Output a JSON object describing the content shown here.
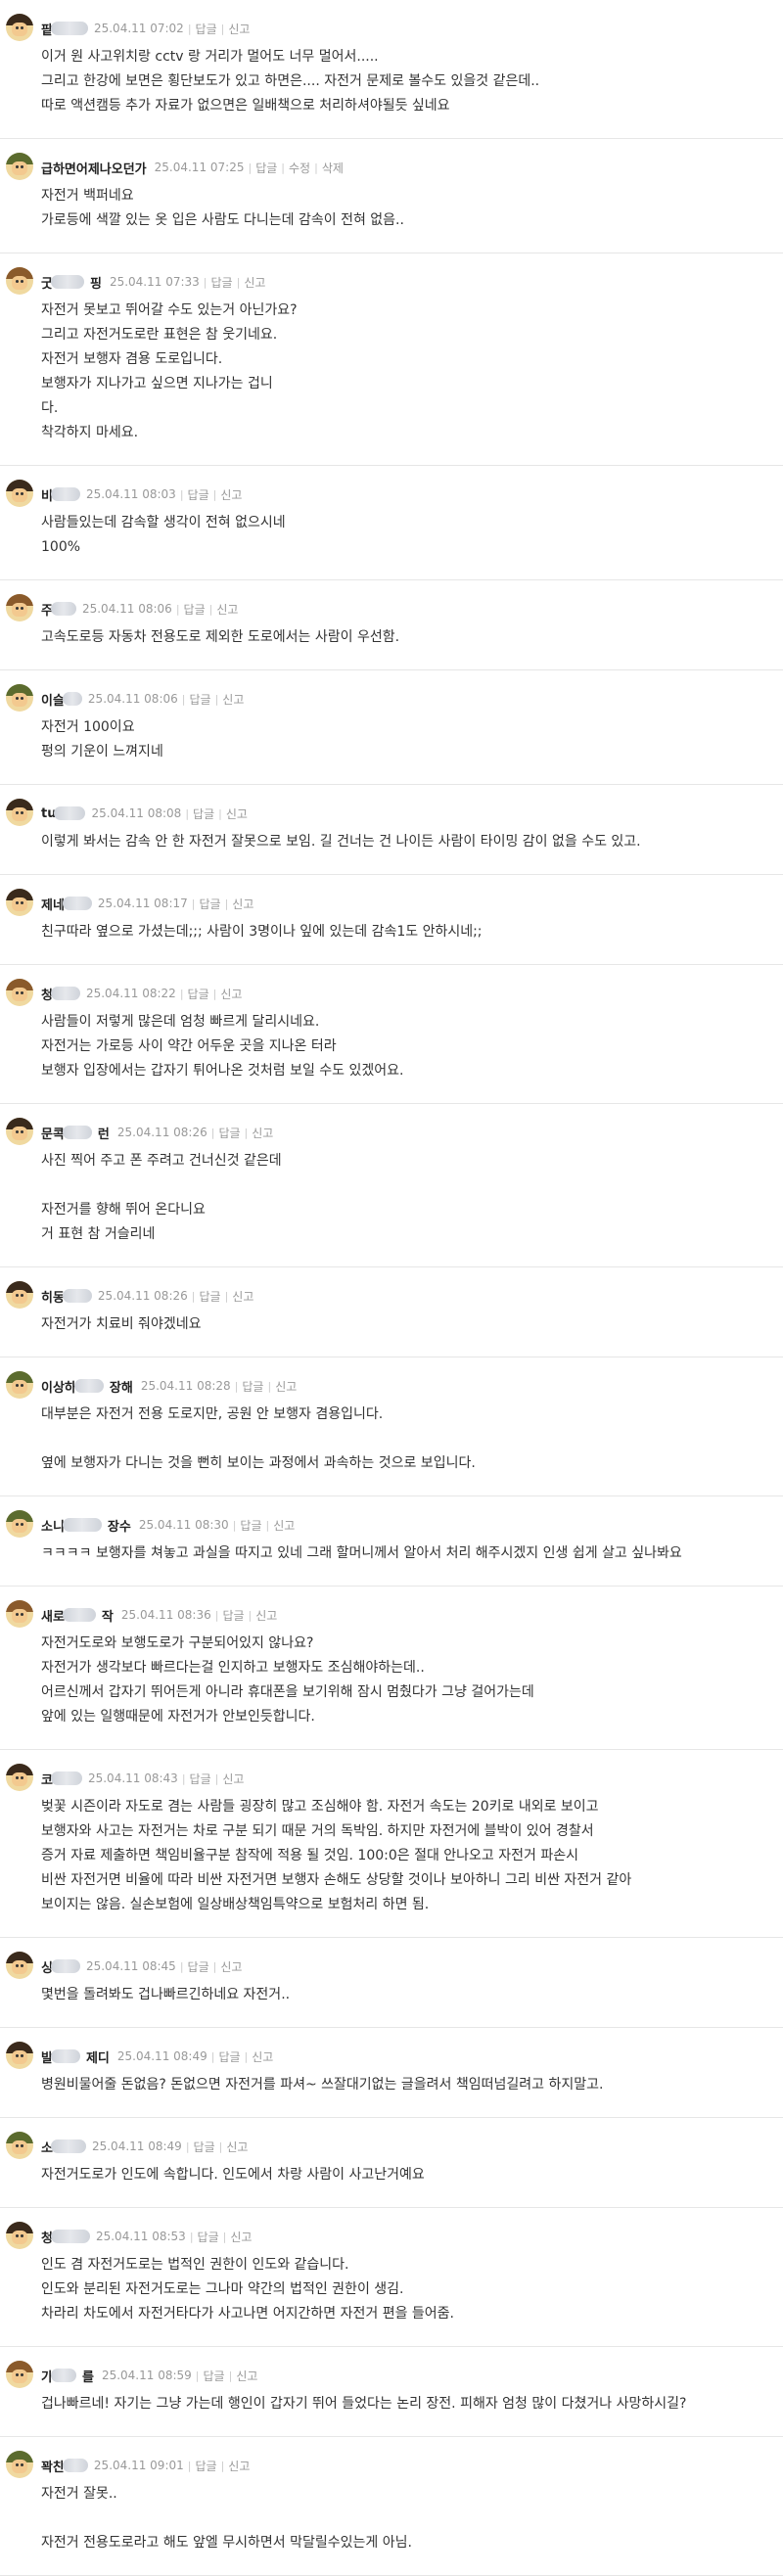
{
  "comments": [
    {
      "nick": "팥",
      "blur": 38,
      "time": "25.04.11 07:02",
      "actions": [
        "답글",
        "신고"
      ],
      "avatar": "hair-dark",
      "lines": [
        "이거 원 사고위치랑 cctv 랑 거리가 멀어도 너무 멀어서.....",
        "그리고 한강에 보면은 횡단보도가 있고 하면은.... 자전거 문제로 볼수도 있을것 같은데..",
        "따로 액션캠등 추가 자료가 없으면은 일배책으로 처리하셔야될듯 싶네요"
      ]
    },
    {
      "nick": "급하면어제나오던가",
      "blur": 0,
      "time": "25.04.11 07:25",
      "actions": [
        "답글",
        "수정",
        "삭제"
      ],
      "avatar": "helmet-green",
      "lines": [
        "자전거 백퍼네요",
        "가로등에 색깔 있는 옷 입은 사람도 다니는데 감속이 전혀 없음.."
      ]
    },
    {
      "nick": "굿",
      "blur": 34,
      "nick2": "핑",
      "time": "25.04.11 07:33",
      "actions": [
        "답글",
        "신고"
      ],
      "avatar": "hair-brown",
      "lines": [
        "자전거 못보고 뛰어갈 수도 있는거 아닌가요?",
        "그리고 자전거도로란 표현은 참 웃기네요.",
        "자전거 보행자 겸용 도로입니다.",
        "보행자가 지나가고 싶으면 지나가는 겁니",
        "다.",
        "착각하지 마세요."
      ]
    },
    {
      "nick": "비",
      "blur": 30,
      "time": "25.04.11 08:03",
      "actions": [
        "답글",
        "신고"
      ],
      "avatar": "hair-dark",
      "lines": [
        "사람들있는데 감속할 생각이 전혀 없으시네",
        "100%"
      ]
    },
    {
      "nick": "주",
      "blur": 26,
      "time": "25.04.11 08:06",
      "actions": [
        "답글",
        "신고"
      ],
      "avatar": "hair-brown",
      "lines": [
        "고속도로등 자동차 전용도로 제외한 도로에서는 사람이 우선함."
      ]
    },
    {
      "nick": "이슬",
      "blur": 20,
      "time": "25.04.11 08:06",
      "actions": [
        "답글",
        "신고"
      ],
      "avatar": "helmet-green",
      "lines": [
        "자전거 100이요",
        "펑의 기운이 느껴지네"
      ]
    },
    {
      "nick": "tu",
      "blur": 32,
      "time": "25.04.11 08:08",
      "actions": [
        "답글",
        "신고"
      ],
      "avatar": "hair-dark",
      "lines": [
        "이렇게 봐서는 감속 안 한 자전거 잘못으로 보임. 길 건너는 건 나이든 사람이 타이밍 감이 없을 수도 있고."
      ]
    },
    {
      "nick": "제네",
      "blur": 30,
      "time": "25.04.11 08:17",
      "actions": [
        "답글",
        "신고"
      ],
      "avatar": "hair-dark",
      "lines": [
        "친구따라 옆으로 가셨는데;;; 사람이 3명이나 잎에 있는데 감속1도 안하시네;;"
      ]
    },
    {
      "nick": "청",
      "blur": 30,
      "time": "25.04.11 08:22",
      "actions": [
        "답글",
        "신고"
      ],
      "avatar": "hair-brown",
      "lines": [
        "사람들이 저렇게 많은데 엄청 빠르게 달리시네요.",
        "자전거는 가로등 사이 약간 어두운 곳을 지나온 터라",
        "보행자 입장에서는 갑자기 튀어나온 것처럼 보일 수도 있겠어요."
      ]
    },
    {
      "nick": "문콕",
      "blur": 30,
      "nick2": "런",
      "time": "25.04.11 08:26",
      "actions": [
        "답글",
        "신고"
      ],
      "avatar": "hair-dark",
      "lines": [
        "사진 찍어 주고 폰 주려고 건너신것 같은데",
        "",
        "자전거를 향해 뛰어 온다니요",
        "거 표현 참 거슬리네"
      ]
    },
    {
      "nick": "히동",
      "blur": 30,
      "time": "25.04.11 08:26",
      "actions": [
        "답글",
        "신고"
      ],
      "avatar": "hair-dark",
      "lines": [
        "자전거가 치료비 줘야겠네요"
      ]
    },
    {
      "nick": "이상하",
      "blur": 30,
      "nick2": "장해",
      "time": "25.04.11 08:28",
      "actions": [
        "답글",
        "신고"
      ],
      "avatar": "helmet-green",
      "lines": [
        "대부분은 자전거 전용 도로지만, 공원 안 보행자 겸용입니다.",
        "",
        "옆에 보행자가 다니는 것을 뻔히 보이는 과정에서 과속하는 것으로 보입니다."
      ]
    },
    {
      "nick": "소니",
      "blur": 40,
      "nick2": "장수",
      "time": "25.04.11 08:30",
      "actions": [
        "답글",
        "신고"
      ],
      "avatar": "helmet-green",
      "lines": [
        "ㅋㅋㅋㅋ 보행자를 쳐놓고 과실을 따지고 있네 그래 할머니께서 알아서 처리 해주시겠지 인생 쉽게 살고 싶나봐요"
      ]
    },
    {
      "nick": "새로",
      "blur": 34,
      "nick2": "작",
      "time": "25.04.11 08:36",
      "actions": [
        "답글",
        "신고"
      ],
      "avatar": "hair-brown",
      "lines": [
        "자전거도로와 보행도로가 구분되어있지 않나요?",
        "자전거가 생각보다 빠르다는걸 인지하고 보행자도 조심해야하는데..",
        "어르신께서 갑자기 뛰어든게 아니라 휴대폰을 보기위해 잠시 멈췄다가 그냥 걸어가는데",
        "앞에 있는 일행때문에 자전거가 안보인듯합니다."
      ]
    },
    {
      "nick": "코",
      "blur": 32,
      "time": "25.04.11 08:43",
      "actions": [
        "답글",
        "신고"
      ],
      "avatar": "hair-dark",
      "lines": [
        "벚꽃 시즌이라 자도로 겸는 사람들 굉장히 많고 조심해야 함. 자전거 속도는 20키로 내외로 보이고",
        "보행자와 사고는 자전거는 차로 구분 되기 때문 거의 독박임. 하지만 자전거에 블박이 있어 경찰서",
        "증거 자료 제출하면 책임비율구분 참작에 적용 될 것임. 100:0은 절대 안나오고 자전거 파손시",
        "비싼 자전거면 비율에 따라 비싼 자전거면 보행자 손해도 상당할 것이나 보아하니 그리 비싼 자전거 같아",
        "보이지는 않음. 실손보험에 일상배상책임특약으로 보험처리 하면 됨."
      ]
    },
    {
      "nick": "싱",
      "blur": 30,
      "time": "25.04.11 08:45",
      "actions": [
        "답글",
        "신고"
      ],
      "avatar": "hair-dark",
      "lines": [
        "몇번을 돌려봐도 겁나빠르긴하네요 자전거.."
      ]
    },
    {
      "nick": "발",
      "blur": 30,
      "nick2": "제디",
      "time": "25.04.11 08:49",
      "actions": [
        "답글",
        "신고"
      ],
      "avatar": "hair-dark",
      "lines": [
        "병원비물어줄 돈없음? 돈없으면 자전거를 파셔~ 쓰잘대기없는 글을려서 책임떠넘길려고 하지말고."
      ]
    },
    {
      "nick": "소",
      "blur": 36,
      "time": "25.04.11 08:49",
      "actions": [
        "답글",
        "신고"
      ],
      "avatar": "helmet-green",
      "lines": [
        "자전거도로가 인도에 속합니다. 인도에서 차랑 사람이 사고난거예요"
      ]
    },
    {
      "nick": "청",
      "blur": 40,
      "time": "25.04.11 08:53",
      "actions": [
        "답글",
        "신고"
      ],
      "avatar": "hair-dark",
      "lines": [
        "인도 겸 자전거도로는 법적인 권한이 인도와 같습니다.",
        "인도와 분리된 자전거도로는 그나마 약간의 법적인 권한이 생김.",
        "차라리 차도에서 자전거타다가 사고나면 어지간하면 자전거 편을 들어줌."
      ]
    },
    {
      "nick": "가",
      "blur": 26,
      "nick2": "를",
      "time": "25.04.11 08:59",
      "actions": [
        "답글",
        "신고"
      ],
      "avatar": "hair-brown",
      "lines": [
        "겁나빠르네! 자기는 그냥 가는데 행인이 갑자기 뛰어 들었다는 논리 장전. 피해자 엄청 많이 다쳤거나 사망하시길?"
      ]
    },
    {
      "nick": "꽉찬",
      "blur": 26,
      "time": "25.04.11 09:01",
      "actions": [
        "답글",
        "신고"
      ],
      "avatar": "helmet-green",
      "lines": [
        "자전거 잘못..",
        "",
        "자전거 전용도로라고 해도 앞엘 무시하면서 막달릴수있는게 아님."
      ]
    }
  ],
  "colors": {
    "meta": "#999999",
    "text": "#333333",
    "divider": "#e6e6e6",
    "nick": "#222222"
  }
}
